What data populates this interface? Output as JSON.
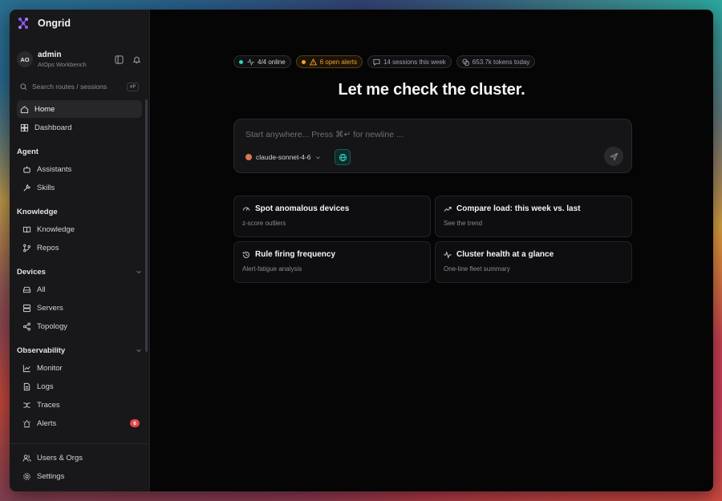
{
  "app": {
    "name": "Ongrid"
  },
  "user": {
    "initials": "AO",
    "name": "admin",
    "role": "AIOps Workbench"
  },
  "search": {
    "placeholder": "Search routes / sessions",
    "shortcut": "⌘P"
  },
  "nav": {
    "home": "Home",
    "dashboard": "Dashboard",
    "sections": {
      "agent": "Agent",
      "knowledge": "Knowledge",
      "devices": "Devices",
      "observability": "Observability"
    },
    "agent_items": [
      "Assistants",
      "Skills"
    ],
    "knowledge_items": [
      "Knowledge",
      "Repos"
    ],
    "device_items": [
      "All",
      "Servers",
      "Topology"
    ],
    "observability_items": [
      "Monitor",
      "Logs",
      "Traces",
      "Alerts"
    ],
    "alerts_badge": "6",
    "bottom_items": [
      "Users & Orgs",
      "Settings"
    ]
  },
  "status": {
    "online": "4/4 online",
    "alerts": "6 open alerts",
    "sessions": "14 sessions this week",
    "tokens": "653.7k tokens today"
  },
  "headline": "Let me check the cluster.",
  "composer": {
    "placeholder": "Start anywhere... Press ⌘↵ for newline ...",
    "model": "claude-sonnet-4-6"
  },
  "suggestions": [
    {
      "title": "Spot anomalous devices",
      "subtitle": "z-score outliers",
      "icon": "gauge-icon"
    },
    {
      "title": "Compare load: this week vs. last",
      "subtitle": "See the trend",
      "icon": "trend-up-icon"
    },
    {
      "title": "Rule firing frequency",
      "subtitle": "Alert-fatigue analysis",
      "icon": "history-icon"
    },
    {
      "title": "Cluster health at a glance",
      "subtitle": "One-line fleet summary",
      "icon": "pulse-icon"
    }
  ],
  "colors": {
    "accent_online": "#2dd4bf",
    "accent_alert": "#f5a524",
    "badge": "#e5484d",
    "model_dot": "#d97757"
  }
}
